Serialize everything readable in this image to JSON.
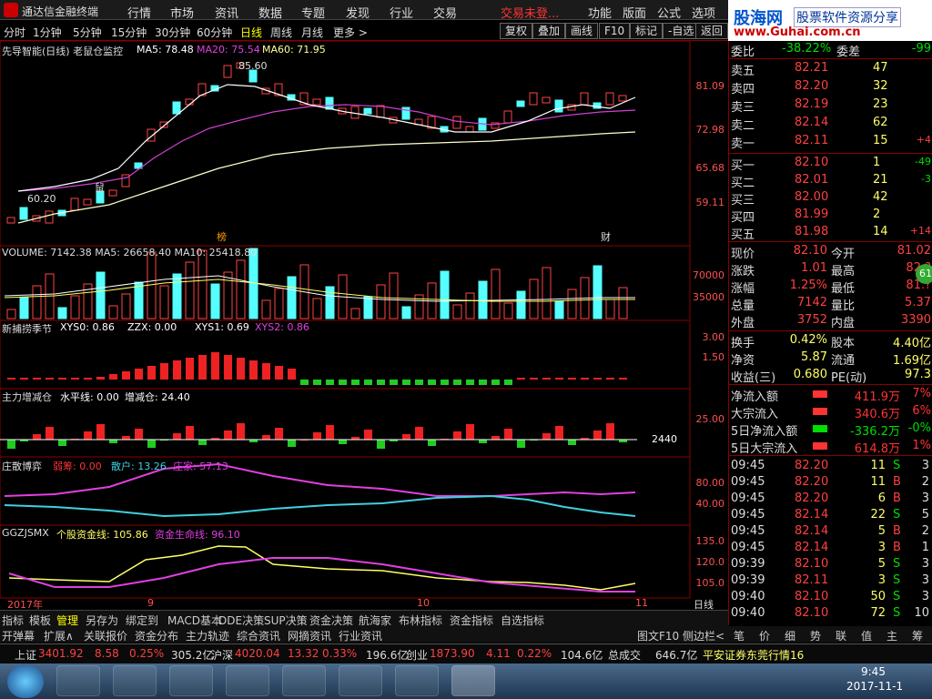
{
  "app": {
    "name": "通达信金融终端",
    "menus": [
      "行情",
      "市场",
      "资讯",
      "数据",
      "专题",
      "发现",
      "行业",
      "交易"
    ],
    "trade_status": "交易未登...",
    "menus_right": [
      "功能",
      "版面",
      "公式",
      "选项"
    ],
    "window_controls": [
      "_",
      "□",
      "×"
    ]
  },
  "logo": {
    "line1": "股海网",
    "line2": "股票软件资源分享",
    "url": "www.Guhai.com.cn"
  },
  "periods": {
    "tabs": [
      "分时",
      "1分钟",
      "5分钟",
      "15分钟",
      "30分钟",
      "60分钟",
      "日线",
      "周线",
      "月线",
      "更多 >"
    ],
    "active": "日线",
    "buttons": [
      "复权",
      "叠加",
      "画线",
      "F10",
      "标记",
      "-自选",
      "返回"
    ]
  },
  "main_chart": {
    "title": "先导智能(日线) 老鼠仓监控",
    "ma5": "MA5: 78.48",
    "ma20": "MA20: 75.54",
    "ma60": "MA60: 71.95",
    "yticks": [
      "81.09",
      "72.98",
      "65.68",
      "59.11"
    ],
    "high_mark": "85.60",
    "low_mark": "60.20",
    "mouse_label": "鼠",
    "bang_label": "榜",
    "cai_label": "财"
  },
  "volume_panel": {
    "label": "VOLUME: 7142.38  MA5: 26658.40  MA10: 25418.80",
    "yticks": [
      "70000",
      "35000"
    ]
  },
  "panel2": {
    "name": "新捕捞季节",
    "xys0": "XYS0: 0.86",
    "zzx": "ZZX: 0.00",
    "xys1": "XYS1: 0.69",
    "xys2": "XYS2: 0.86",
    "yticks": [
      "3.00",
      "1.50"
    ]
  },
  "panel3": {
    "name": "主力增减仓",
    "hline": "水平线: 0.00",
    "incr": "增减仓: 24.40",
    "yticks": [
      "25.00"
    ],
    "value": "2440"
  },
  "panel4": {
    "name": "庄散博弈",
    "weak": "弱筹: 0.00",
    "retail": "散户: 13.26",
    "dealer": "庄家: 57.13",
    "yticks": [
      "80.00",
      "40.00"
    ]
  },
  "panel5": {
    "name": "GGZJSMX",
    "fund": "个股资金线: 105.86",
    "life": "资金生命线: 96.10",
    "yticks": [
      "135.0",
      "120.0",
      "105.0"
    ]
  },
  "xaxis": {
    "labels": [
      "2017年",
      "9",
      "10",
      "11"
    ],
    "period": "日线"
  },
  "tabs_row1": [
    "指标",
    "模板",
    "管理",
    "另存为",
    "绑定到",
    "MACD基本",
    "DDE决策",
    "SUP决策",
    "资金决策",
    "航海家",
    "布林指标",
    "资金指标",
    "自选指标"
  ],
  "tabs_row2": [
    "开弹幕",
    "扩展∧",
    "关联报价",
    "资金分布",
    "主力轨迹",
    "综合资讯",
    "网摘资讯",
    "行业资讯"
  ],
  "tabs_row2_right": [
    "图文F10",
    "侧边栏<"
  ],
  "right_tabs": [
    "笔",
    "价",
    "细",
    "势",
    "联",
    "值",
    "主",
    "筹"
  ],
  "quote": {
    "weibi_label": "委比",
    "weibi": "-38.22%",
    "weicha_label": "委差",
    "weicha": "-99",
    "asks": [
      {
        "label": "卖五",
        "price": "82.21",
        "vol": "47",
        "chg": ""
      },
      {
        "label": "卖四",
        "price": "82.20",
        "vol": "32",
        "chg": ""
      },
      {
        "label": "卖三",
        "price": "82.19",
        "vol": "23",
        "chg": ""
      },
      {
        "label": "卖二",
        "price": "82.14",
        "vol": "62",
        "chg": ""
      },
      {
        "label": "卖一",
        "price": "82.11",
        "vol": "15",
        "chg": "+4"
      }
    ],
    "bids": [
      {
        "label": "买一",
        "price": "82.10",
        "vol": "1",
        "chg": "-49"
      },
      {
        "label": "买二",
        "price": "82.01",
        "vol": "21",
        "chg": "-3"
      },
      {
        "label": "买三",
        "price": "82.00",
        "vol": "42",
        "chg": ""
      },
      {
        "label": "买四",
        "price": "81.99",
        "vol": "2",
        "chg": ""
      },
      {
        "label": "买五",
        "price": "81.98",
        "vol": "14",
        "chg": "+14"
      }
    ],
    "stats": [
      [
        "现价",
        "82.10",
        "今开",
        "81.02"
      ],
      [
        "涨跌",
        "1.01",
        "最高",
        "82.?"
      ],
      [
        "涨幅",
        "1.25%",
        "最低",
        "81.?"
      ],
      [
        "总量",
        "7142",
        "量比",
        "5.37"
      ],
      [
        "外盘",
        "3752",
        "内盘",
        "3390"
      ]
    ],
    "fund": [
      [
        "换手",
        "0.42%",
        "股本",
        "4.40亿"
      ],
      [
        "净资",
        "5.87",
        "流通",
        "1.69亿"
      ],
      [
        "收益(三)",
        "0.680",
        "PE(动)",
        "97.3"
      ]
    ],
    "flows": [
      {
        "label": "净流入额",
        "value": "411.9万",
        "pct": "7%",
        "color": "red"
      },
      {
        "label": "大宗流入",
        "value": "340.6万",
        "pct": "6%",
        "color": "red"
      },
      {
        "label": "5日净流入额",
        "value": "-336.2万",
        "pct": "-0%",
        "color": "green"
      },
      {
        "label": "5日大宗流入",
        "value": "614.8万",
        "pct": "1%",
        "color": "red"
      }
    ],
    "ticks": [
      [
        "09:45",
        "82.20",
        "11",
        "S",
        "3"
      ],
      [
        "09:45",
        "82.20",
        "11",
        "B",
        "2"
      ],
      [
        "09:45",
        "82.20",
        "6",
        "B",
        "3"
      ],
      [
        "09:45",
        "82.14",
        "22",
        "S",
        "5"
      ],
      [
        "09:45",
        "82.14",
        "5",
        "B",
        "2"
      ],
      [
        "09:45",
        "82.14",
        "3",
        "B",
        "1"
      ],
      [
        "09:39",
        "82.10",
        "5",
        "S",
        "3"
      ],
      [
        "09:39",
        "82.11",
        "3",
        "S",
        "3"
      ],
      [
        "09:40",
        "82.10",
        "50",
        "S",
        "3"
      ],
      [
        "09:40",
        "82.10",
        "72",
        "S",
        "10"
      ]
    ],
    "badge": "61"
  },
  "status": {
    "sh_label": "上证",
    "sh": "3401.92",
    "sh_chg": "8.58",
    "sh_pct": "0.25%",
    "sh_amt": "305.2亿",
    "sz_label": "沪深",
    "sz": "4020.04",
    "sz_chg": "13.32",
    "sz_pct": "0.33%",
    "sz_amt": "196.6亿",
    "cy_label": "创业",
    "cy": "1873.90",
    "cy_chg": "4.11",
    "cy_pct": "0.22%",
    "cy_amt": "104.6亿",
    "total_label": "总成交",
    "total": "646.7亿",
    "broker": "平安证券东莞行情16"
  },
  "taskbar": {
    "time": "9:45",
    "date": "2017-11-1"
  }
}
